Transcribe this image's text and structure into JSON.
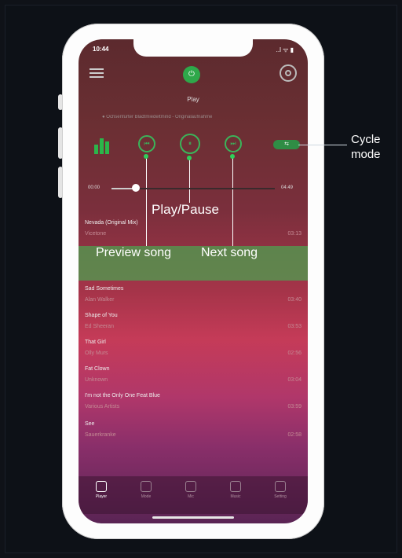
{
  "status": {
    "time": "10:44",
    "right": "..l ᯤ ▮"
  },
  "header": {
    "title": "Play",
    "now_playing": "● Ochsenfurter Bladtmiedeltmind - Originalaufnahme"
  },
  "callouts": {
    "play_pause": "Play/Pause",
    "preview": "Preview song",
    "next": "Next song",
    "cycle": "Cycle mode"
  },
  "player": {
    "time_elapsed": "00:00",
    "time_total": "04:49",
    "progress": 0.15,
    "prev_symbol": "⏮",
    "play_symbol": "⏸",
    "next_symbol": "⏭",
    "cycle_symbol": "⇆"
  },
  "songs": [
    {
      "title": "Nevada (Original Mix)",
      "artist": "Vicetone",
      "duration": "03:13"
    },
    {
      "title": "Sad Sometimes",
      "artist": "Alan Walker",
      "duration": "03:40"
    },
    {
      "title": "Shape of You",
      "artist": "Ed Sheeran",
      "duration": "03:53"
    },
    {
      "title": "That Girl",
      "artist": "Olly Murs",
      "duration": "02:56"
    },
    {
      "title": "Fat Clown",
      "artist": "Unknown",
      "duration": "03:04"
    },
    {
      "title": "I'm not the Only One Feat Blue",
      "artist": "Various Artists",
      "duration": "03:59"
    },
    {
      "title": "See",
      "artist": "Sauerkranke",
      "duration": "02:58"
    }
  ],
  "tabs": [
    {
      "label": "Player",
      "icon": "bars-icon"
    },
    {
      "label": "Mode",
      "icon": "mode-icon"
    },
    {
      "label": "Mic",
      "icon": "mic-icon"
    },
    {
      "label": "Music",
      "icon": "music-icon"
    },
    {
      "label": "Setting",
      "icon": "setting-icon"
    }
  ],
  "colors": {
    "accent": "#2ea84a",
    "highlight": "#4ea050"
  }
}
